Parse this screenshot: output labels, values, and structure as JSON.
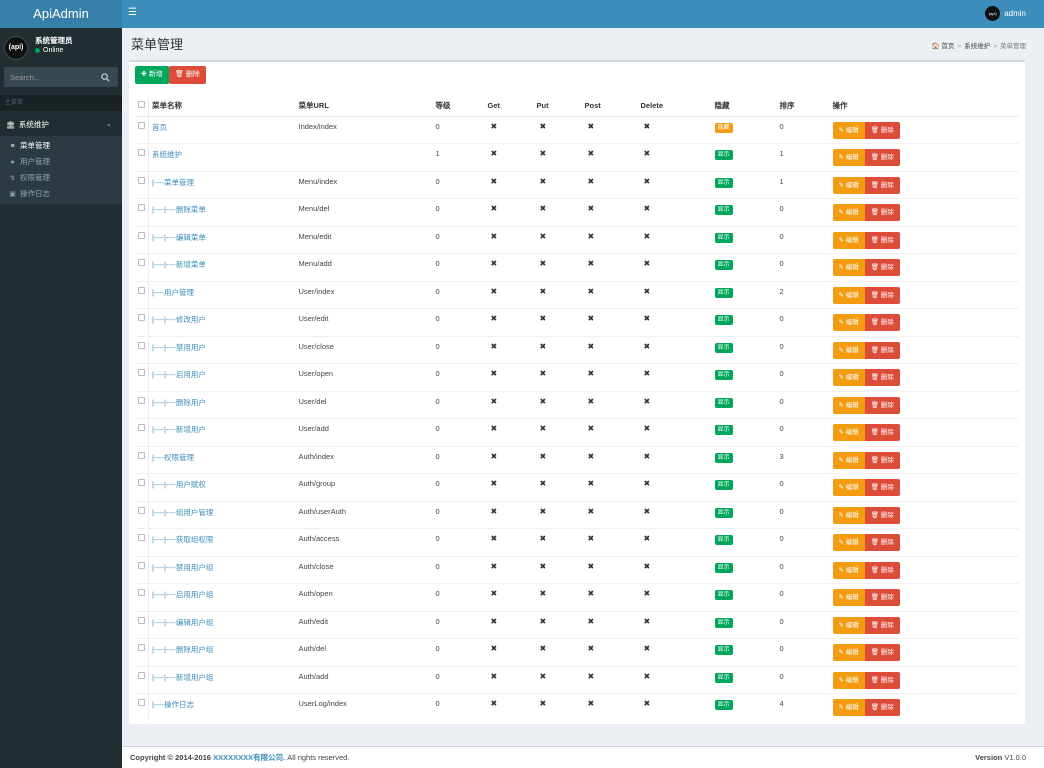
{
  "app": {
    "logo": "ApiAdmin"
  },
  "user": {
    "avatar_text": "(api)",
    "name": "系统管理员",
    "status": "Online"
  },
  "search": {
    "placeholder": "Search..."
  },
  "nav": {
    "header": "主菜单",
    "group_label": "系统维护",
    "items": [
      {
        "label": "菜单管理",
        "icon": "list-icon",
        "active": true
      },
      {
        "label": "用户管理",
        "icon": "users-icon",
        "active": false
      },
      {
        "label": "权限管理",
        "icon": "bolt-icon",
        "active": false
      },
      {
        "label": "操作日志",
        "icon": "file-icon",
        "active": false
      }
    ]
  },
  "header": {
    "admin_label": "admin",
    "admin_avatar": "(api)"
  },
  "page": {
    "title": "菜单管理",
    "breadcrumb": [
      "首页",
      "系统维护",
      "菜单管理"
    ]
  },
  "toolbar": {
    "add_label": "新增",
    "delete_label": "删除"
  },
  "table": {
    "columns": [
      "菜单名称",
      "菜单URL",
      "等级",
      "Get",
      "Put",
      "Post",
      "Delete",
      "隐藏",
      "排序",
      "操作"
    ],
    "edit_label": "编辑",
    "delete_label": "删除",
    "rows": [
      {
        "name": "首页",
        "url": "Index/index",
        "level": "0",
        "hidden": "隐藏",
        "hide": true,
        "sort": "0"
      },
      {
        "name": "系统维护",
        "url": "",
        "level": "1",
        "hidden": "显示",
        "hide": false,
        "sort": "1"
      },
      {
        "name": "|----菜单管理",
        "url": "Menu/index",
        "level": "0",
        "hidden": "显示",
        "hide": false,
        "sort": "1"
      },
      {
        "name": "|----|----删除菜单",
        "url": "Menu/del",
        "level": "0",
        "hidden": "显示",
        "hide": false,
        "sort": "0"
      },
      {
        "name": "|----|----编辑菜单",
        "url": "Menu/edit",
        "level": "0",
        "hidden": "显示",
        "hide": false,
        "sort": "0"
      },
      {
        "name": "|----|----新增菜单",
        "url": "Menu/add",
        "level": "0",
        "hidden": "显示",
        "hide": false,
        "sort": "0"
      },
      {
        "name": "|----用户管理",
        "url": "User/index",
        "level": "0",
        "hidden": "显示",
        "hide": false,
        "sort": "2"
      },
      {
        "name": "|----|----修改用户",
        "url": "User/edit",
        "level": "0",
        "hidden": "显示",
        "hide": false,
        "sort": "0"
      },
      {
        "name": "|----|----禁用用户",
        "url": "User/close",
        "level": "0",
        "hidden": "显示",
        "hide": false,
        "sort": "0"
      },
      {
        "name": "|----|----启用用户",
        "url": "User/open",
        "level": "0",
        "hidden": "显示",
        "hide": false,
        "sort": "0"
      },
      {
        "name": "|----|----删除用户",
        "url": "User/del",
        "level": "0",
        "hidden": "显示",
        "hide": false,
        "sort": "0"
      },
      {
        "name": "|----|----新增用户",
        "url": "User/add",
        "level": "0",
        "hidden": "显示",
        "hide": false,
        "sort": "0"
      },
      {
        "name": "|----权限管理",
        "url": "Auth/index",
        "level": "0",
        "hidden": "显示",
        "hide": false,
        "sort": "3"
      },
      {
        "name": "|----|----用户赋权",
        "url": "Auth/group",
        "level": "0",
        "hidden": "显示",
        "hide": false,
        "sort": "0"
      },
      {
        "name": "|----|----组用户管理",
        "url": "Auth/userAuth",
        "level": "0",
        "hidden": "显示",
        "hide": false,
        "sort": "0"
      },
      {
        "name": "|----|----获取组权限",
        "url": "Auth/access",
        "level": "0",
        "hidden": "显示",
        "hide": false,
        "sort": "0"
      },
      {
        "name": "|----|----禁用用户组",
        "url": "Auth/close",
        "level": "0",
        "hidden": "显示",
        "hide": false,
        "sort": "0"
      },
      {
        "name": "|----|----启用用户组",
        "url": "Auth/open",
        "level": "0",
        "hidden": "显示",
        "hide": false,
        "sort": "0"
      },
      {
        "name": "|----|----编辑用户组",
        "url": "Auth/edit",
        "level": "0",
        "hidden": "显示",
        "hide": false,
        "sort": "0"
      },
      {
        "name": "|----|----删除用户组",
        "url": "Auth/del",
        "level": "0",
        "hidden": "显示",
        "hide": false,
        "sort": "0"
      },
      {
        "name": "|----|----新增用户组",
        "url": "Auth/add",
        "level": "0",
        "hidden": "显示",
        "hide": false,
        "sort": "0"
      },
      {
        "name": "|----操作日志",
        "url": "UserLog/index",
        "level": "0",
        "hidden": "显示",
        "hide": false,
        "sort": "4"
      }
    ]
  },
  "footer": {
    "copyright": "Copyright © 2014-2016",
    "company": "XXXXXXXX有限公司.",
    "rights": "All rights reserved.",
    "version_label": "Version",
    "version": "V1.0.0"
  },
  "colors": {
    "header": "#3c8dbc",
    "logo_bg": "#367fa9",
    "sidebar": "#222d32",
    "success": "#00a65a",
    "warning": "#f39c12",
    "danger": "#dd4b39",
    "link": "#3c8dbc"
  }
}
